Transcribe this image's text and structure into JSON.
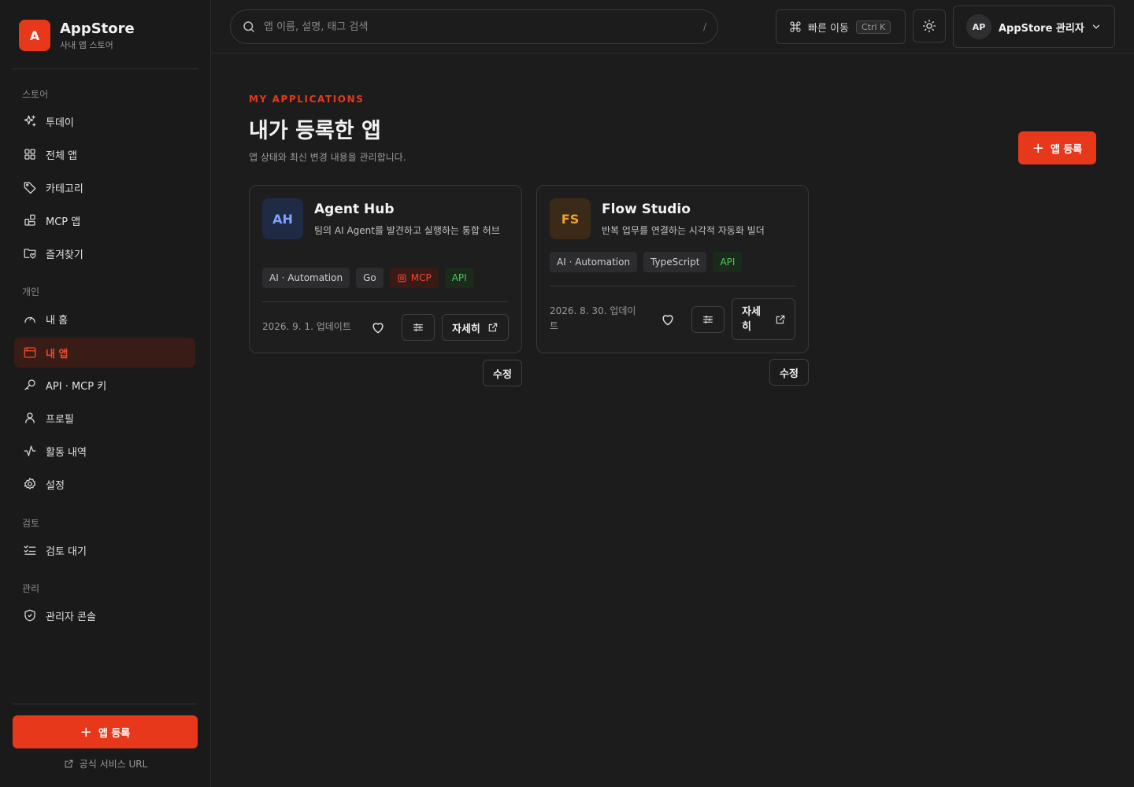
{
  "brand": {
    "logo_letter": "A",
    "name": "AppStore",
    "subtitle": "사내 앱 스토어"
  },
  "sidebar": {
    "sections": [
      {
        "label": "스토어",
        "items": [
          {
            "label": "투데이",
            "icon": "sparkle-icon"
          },
          {
            "label": "전체 앱",
            "icon": "grid-icon"
          },
          {
            "label": "카테고리",
            "icon": "tag-icon"
          },
          {
            "label": "MCP 앱",
            "icon": "blocks-icon"
          },
          {
            "label": "즐겨찾기",
            "icon": "folder-heart-icon"
          }
        ]
      },
      {
        "label": "개인",
        "items": [
          {
            "label": "내 홈",
            "icon": "gauge-icon"
          },
          {
            "label": "내 앱",
            "icon": "window-icon",
            "active": true
          },
          {
            "label": "API · MCP 키",
            "icon": "key-icon"
          },
          {
            "label": "프로필",
            "icon": "user-icon"
          },
          {
            "label": "활동 내역",
            "icon": "activity-icon"
          },
          {
            "label": "설정",
            "icon": "gear-icon"
          }
        ]
      },
      {
        "label": "검토",
        "items": [
          {
            "label": "검토 대기",
            "icon": "list-check-icon"
          }
        ]
      },
      {
        "label": "관리",
        "items": [
          {
            "label": "관리자 콘솔",
            "icon": "shield-icon"
          }
        ]
      }
    ],
    "cta_label": "앱 등록",
    "footer_link": "공식 서비스 URL"
  },
  "topbar": {
    "search_placeholder": "앱 이름, 설명, 태그 검색",
    "search_shortcut": "/",
    "quick_label": "빠른 이동",
    "quick_kbd": "Ctrl K",
    "user_initials": "AP",
    "user_name": "AppStore 관리자"
  },
  "main": {
    "eyebrow": "MY APPLICATIONS",
    "title": "내가 등록한 앱",
    "description": "앱 상태와 최신 변경 내용을 관리합니다.",
    "add_label": "앱 등록",
    "apps": [
      {
        "initials": "AH",
        "icon_bg": "#1f2a44",
        "icon_color": "#7ea2ff",
        "name": "Agent Hub",
        "description": "팀의 AI Agent를 발견하고 실행하는 통합 허브",
        "tags": [
          "AI · Automation",
          "Go",
          "MCP",
          "API"
        ],
        "updated": "2026. 9. 1. 업데이트",
        "detail_label": "자세히",
        "edit_label": "수정"
      },
      {
        "initials": "FS",
        "icon_bg": "#3a2a17",
        "icon_color": "#f0a030",
        "name": "Flow Studio",
        "description": "반복 업무를 연결하는 시각적 자동화 빌더",
        "tags": [
          "AI · Automation",
          "TypeScript",
          "API"
        ],
        "updated": "2026. 8. 30. 업데이트",
        "detail_label": "자세히",
        "edit_label": "수정"
      }
    ]
  },
  "colors": {
    "accent": "#e8381b",
    "mcp": "#f04a2a",
    "api": "#4cc95a"
  }
}
